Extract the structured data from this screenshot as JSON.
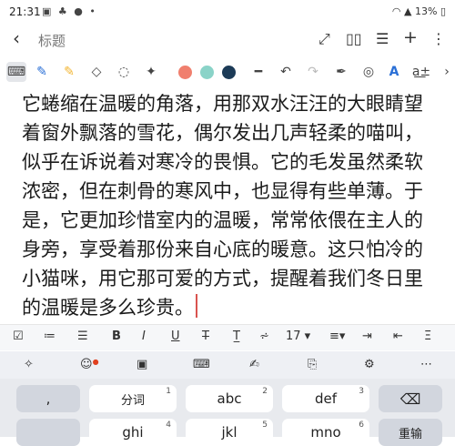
{
  "status": {
    "time": "21:31",
    "battery": "13%"
  },
  "header": {
    "title_placeholder": "标题"
  },
  "content": {
    "text": "它蜷缩在温暖的角落，用那双水汪汪的大眼睛望着窗外飘落的雪花，偶尔发出几声轻柔的喵叫，似乎在诉说着对寒冷的畏惧。它的毛发虽然柔软浓密，但在刺骨的寒风中，也显得有些单薄。于是，它更加珍惜室内的温暖，常常依偎在主人的身旁，享受着那份来自心底的暖意。这只怕冷的小猫咪，用它那可爱的方式，提醒着我们冬日里的温暖是多么珍贵。"
  },
  "toolbar": {
    "colors": [
      "#f07f6e",
      "#8ad3c8",
      "#1c3b57"
    ]
  },
  "format_bar": {
    "font_size": "17"
  },
  "keyboard": {
    "row1": [
      {
        "label": ",",
        "num": ""
      },
      {
        "label": "分词",
        "num": "1"
      },
      {
        "label": "abc",
        "num": "2"
      },
      {
        "label": "def",
        "num": "3"
      }
    ],
    "row2": [
      {
        "label": "ghi",
        "num": "4"
      },
      {
        "label": "jkl",
        "num": "5"
      },
      {
        "label": "mno",
        "num": "6"
      },
      {
        "label": "重输",
        "num": ""
      }
    ]
  }
}
